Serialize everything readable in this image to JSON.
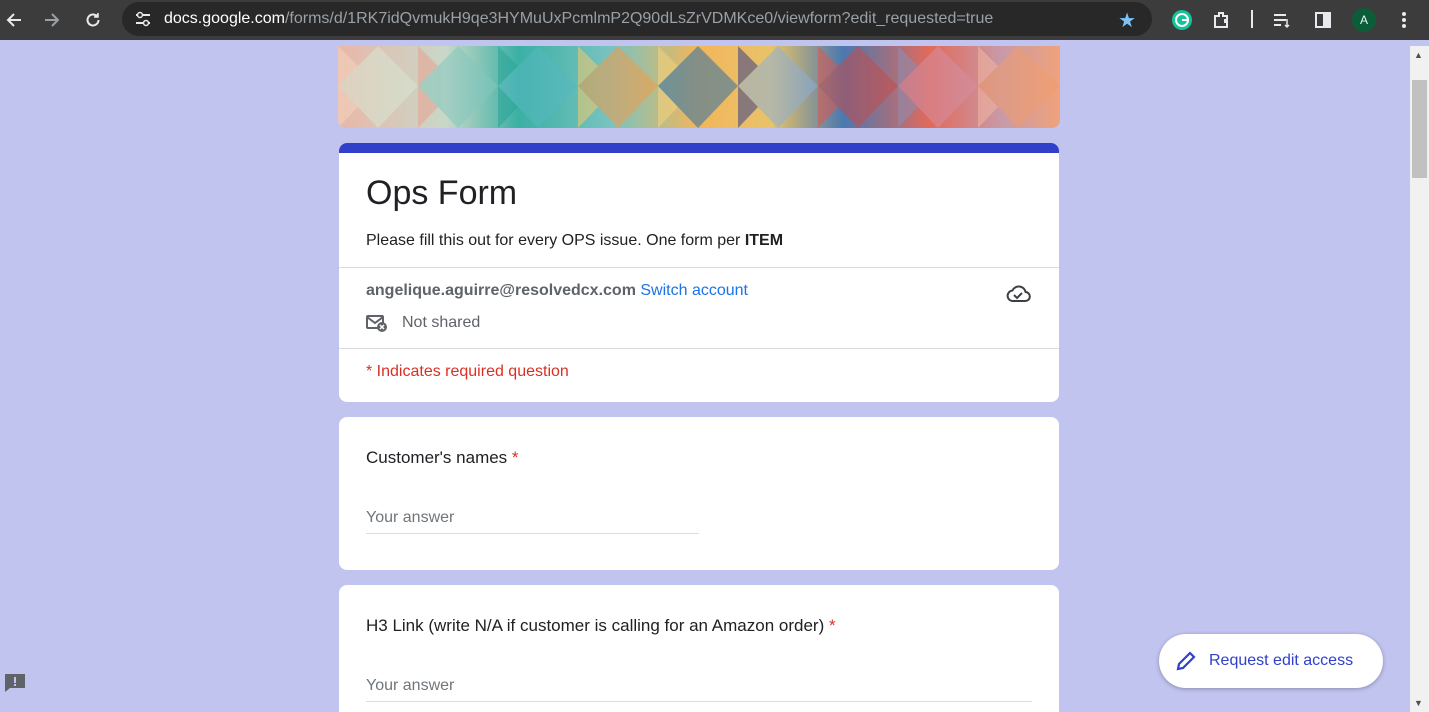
{
  "browser": {
    "url_host": "docs.google.com",
    "url_path": "/forms/d/1RK7idQvmukH9qe3HYMuUxPcmlmP2Q90dLsZrVDMKce0/viewform?edit_requested=true",
    "profile_initial": "A",
    "icons": [
      "back-icon",
      "forward-icon",
      "reload-icon",
      "site-settings-icon",
      "bookmark-star-icon",
      "grammarly-icon",
      "extensions-icon",
      "reading-list-icon",
      "side-panel-icon",
      "menu-icon"
    ]
  },
  "form": {
    "title": "Ops Form",
    "description_prefix": "Please fill this out for every OPS issue. One form per ",
    "description_bold": "ITEM",
    "account_email": "angelique.aguirre@resolvedcx.com",
    "switch_account": "Switch account",
    "not_shared": "Not shared",
    "required_note": "* Indicates required question",
    "accent_color": "#3040c8",
    "background_color": "#c2c4f0"
  },
  "questions": [
    {
      "label": "Customer's names",
      "required_mark": "*",
      "placeholder": "Your answer"
    },
    {
      "label": "H3 Link (write N/A if customer is calling for an Amazon order)",
      "required_mark": "*",
      "placeholder": "Your answer"
    }
  ],
  "floating": {
    "request_edit_label": "Request edit access"
  }
}
